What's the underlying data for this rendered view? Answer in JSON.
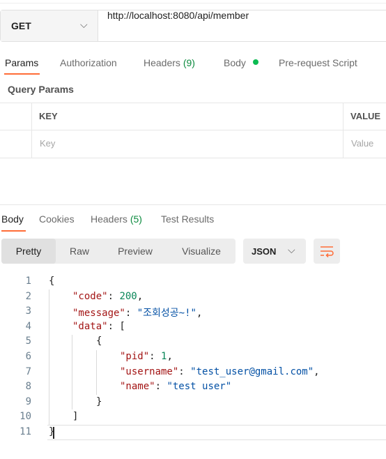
{
  "request": {
    "method": "GET",
    "url": "http://localhost:8080/api/member"
  },
  "request_tabs": [
    {
      "label": "Params",
      "count": ""
    },
    {
      "label": "Authorization",
      "count": ""
    },
    {
      "label": "Headers",
      "count": "(9)"
    },
    {
      "label": "Body",
      "count": ""
    },
    {
      "label": "Pre-request Script",
      "count": ""
    }
  ],
  "params": {
    "title": "Query Params",
    "key_header": "KEY",
    "value_header": "VALUE",
    "key_placeholder": "Key",
    "value_placeholder": "Value"
  },
  "response_tabs": [
    {
      "label": "Body",
      "count": ""
    },
    {
      "label": "Cookies",
      "count": ""
    },
    {
      "label": "Headers",
      "count": "(5)"
    },
    {
      "label": "Test Results",
      "count": ""
    }
  ],
  "view_modes": [
    "Pretty",
    "Raw",
    "Preview",
    "Visualize"
  ],
  "format": "JSON",
  "colors": {
    "accent": "#ff6c37",
    "dot": "#0cbb52",
    "count": "#0b8a3e"
  },
  "body_lines": [
    {
      "n": "1",
      "indent": 0,
      "tokens": [
        [
          "p",
          "{"
        ]
      ]
    },
    {
      "n": "2",
      "indent": 1,
      "tokens": [
        [
          "k",
          "\"code\""
        ],
        [
          "p",
          ": "
        ],
        [
          "n",
          "200"
        ],
        [
          "p",
          ","
        ]
      ]
    },
    {
      "n": "3",
      "indent": 1,
      "tokens": [
        [
          "k",
          "\"message\""
        ],
        [
          "p",
          ": "
        ],
        [
          "s",
          "\"조회성공~!\""
        ],
        [
          "p",
          ","
        ]
      ]
    },
    {
      "n": "4",
      "indent": 1,
      "tokens": [
        [
          "k",
          "\"data\""
        ],
        [
          "p",
          ": ["
        ]
      ]
    },
    {
      "n": "5",
      "indent": 2,
      "tokens": [
        [
          "p",
          "{"
        ]
      ]
    },
    {
      "n": "6",
      "indent": 3,
      "tokens": [
        [
          "k",
          "\"pid\""
        ],
        [
          "p",
          ": "
        ],
        [
          "n",
          "1"
        ],
        [
          "p",
          ","
        ]
      ]
    },
    {
      "n": "7",
      "indent": 3,
      "tokens": [
        [
          "k",
          "\"username\""
        ],
        [
          "p",
          ": "
        ],
        [
          "s",
          "\"test_user@gmail.com\""
        ],
        [
          "p",
          ","
        ]
      ]
    },
    {
      "n": "8",
      "indent": 3,
      "tokens": [
        [
          "k",
          "\"name\""
        ],
        [
          "p",
          ": "
        ],
        [
          "s",
          "\"test user\""
        ]
      ]
    },
    {
      "n": "9",
      "indent": 2,
      "tokens": [
        [
          "p",
          "}"
        ]
      ]
    },
    {
      "n": "10",
      "indent": 1,
      "tokens": [
        [
          "p",
          "]"
        ]
      ]
    },
    {
      "n": "11",
      "indent": 0,
      "tokens": [
        [
          "p",
          "}"
        ]
      ]
    }
  ]
}
